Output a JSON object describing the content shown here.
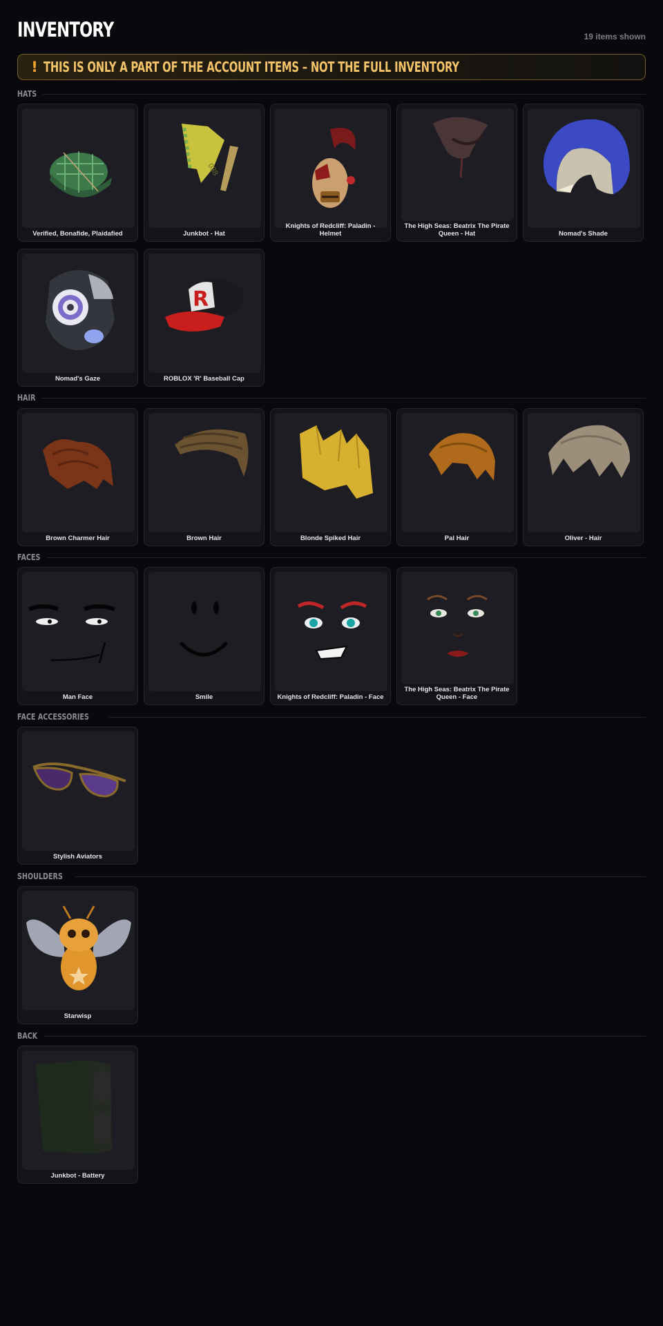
{
  "header": {
    "title": "INVENTORY",
    "count": "19 items shown"
  },
  "banner": {
    "icon": "exclamation-icon",
    "glyph": "!",
    "text": "THIS IS ONLY A PART OF THE ACCOUNT ITEMS – NOT THE FULL INVENTORY"
  },
  "sections": {
    "hats": {
      "label": "HATS",
      "items": [
        {
          "name": "Verified, Bonafide, Plaidafied"
        },
        {
          "name": "Junkbot - Hat"
        },
        {
          "name": "Knights of Redcliff: Paladin - Helmet"
        },
        {
          "name": "The High Seas: Beatrix The Pirate Queen - Hat"
        },
        {
          "name": "Nomad's Shade"
        },
        {
          "name": "Nomad's Gaze"
        },
        {
          "name": "ROBLOX 'R' Baseball Cap"
        }
      ]
    },
    "hair": {
      "label": "HAIR",
      "items": [
        {
          "name": "Brown Charmer Hair"
        },
        {
          "name": "Brown Hair"
        },
        {
          "name": "Blonde Spiked Hair"
        },
        {
          "name": "Pal Hair"
        },
        {
          "name": "Oliver - Hair"
        }
      ]
    },
    "faces": {
      "label": "FACES",
      "items": [
        {
          "name": "Man Face"
        },
        {
          "name": "Smile"
        },
        {
          "name": "Knights of Redcliff: Paladin - Face"
        },
        {
          "name": "The High Seas: Beatrix The Pirate Queen - Face"
        }
      ]
    },
    "face_accessories": {
      "label": "FACE ACCESSORIES",
      "items": [
        {
          "name": "Stylish Aviators"
        }
      ]
    },
    "shoulders": {
      "label": "SHOULDERS",
      "items": [
        {
          "name": "Starwisp"
        }
      ]
    },
    "back": {
      "label": "BACK",
      "items": [
        {
          "name": "Junkbot - Battery"
        }
      ]
    }
  }
}
